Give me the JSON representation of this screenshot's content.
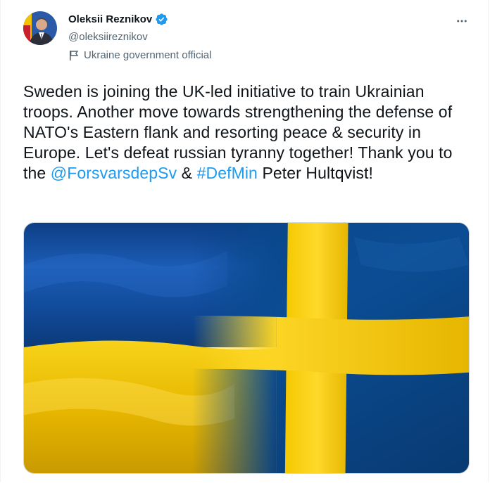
{
  "author": {
    "display_name": "Oleksii Reznikov",
    "handle": "@oleksiireznikov",
    "label": "Ukraine government official",
    "verified": true
  },
  "tweet": {
    "text_before": "Sweden is joining the UK-led initiative to train Ukrainian troops. Another move towards strengthening the defense of NATO's Eastern flank and resorting peace & security in Europe. Let's defeat russian tyranny together! Thank you to the ",
    "mention": "@ForsvarsdepSv",
    "text_mid": " & ",
    "hashtag": "#DefMin",
    "text_after": " Peter Hultqvist!"
  },
  "media": {
    "description": "Ukrainian and Swedish flags merged",
    "colors": {
      "blue": "#1455a8",
      "yellow": "#f2c500",
      "sweden_blue": "#0b4d94"
    }
  },
  "icons": {
    "verified": "verified-badge-icon",
    "label": "government-flag-icon",
    "more": "more-options-icon"
  },
  "colors": {
    "link": "#1d9bf0",
    "secondary_text": "#536471",
    "verified": "#1d9bf0"
  }
}
